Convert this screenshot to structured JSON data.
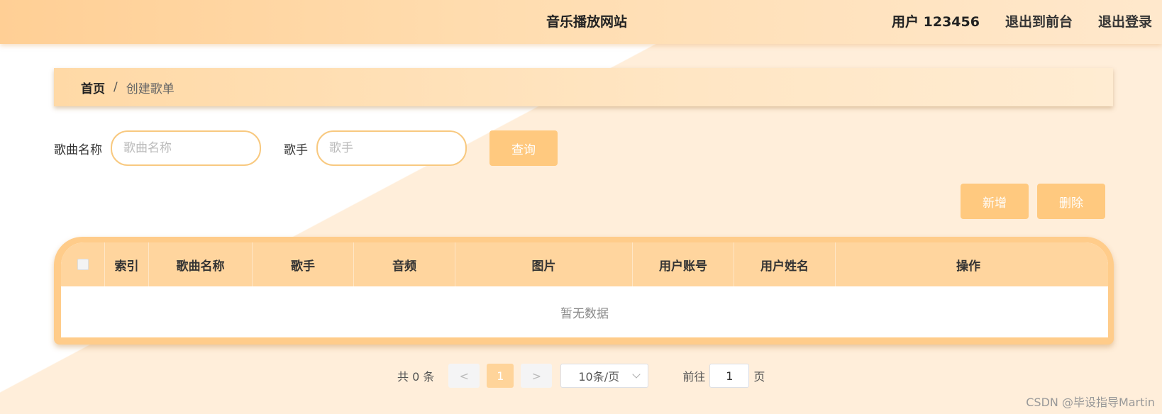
{
  "header": {
    "title": "音乐播放网站",
    "user": "用户 123456",
    "back_to_front": "退出到前台",
    "logout": "退出登录"
  },
  "breadcrumb": {
    "home": "首页",
    "separator": "/",
    "current": "创建歌单"
  },
  "search": {
    "song_label": "歌曲名称",
    "song_placeholder": "歌曲名称",
    "song_value": "",
    "singer_label": "歌手",
    "singer_placeholder": "歌手",
    "singer_value": "",
    "query_button": "查询"
  },
  "actions": {
    "add": "新增",
    "delete": "删除"
  },
  "table": {
    "columns": [
      "索引",
      "歌曲名称",
      "歌手",
      "音频",
      "图片",
      "用户账号",
      "用户姓名",
      "操作"
    ],
    "empty_text": "暂无数据"
  },
  "pagination": {
    "total": "共 0 条",
    "prev": "<",
    "current_page": "1",
    "next": ">",
    "page_size": "10条/页",
    "goto_label": "前往",
    "goto_value": "1",
    "page_unit": "页"
  },
  "watermark": "CSDN @毕设指导Martin",
  "colors": {
    "accent": "#ffc97f",
    "header_bg": "#ffcf95",
    "table_border": "#ffcc8a",
    "table_header": "#ffd59e"
  }
}
